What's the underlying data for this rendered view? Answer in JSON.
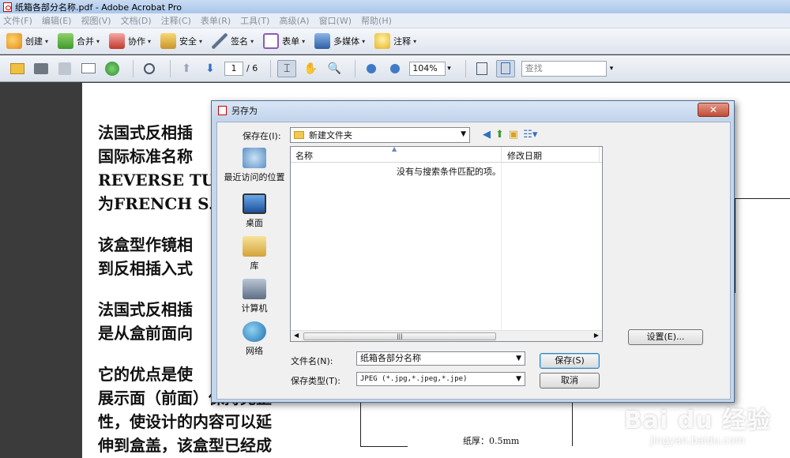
{
  "window": {
    "title": "纸箱各部分名称.pdf - Adobe Acrobat Pro"
  },
  "menu": [
    "文件(F)",
    "编辑(E)",
    "视图(V)",
    "文档(D)",
    "注释(C)",
    "表单(R)",
    "工具(T)",
    "高级(A)",
    "窗口(W)",
    "帮助(H)"
  ],
  "toolbar1": {
    "create": "创建",
    "combine": "合并",
    "collaborate": "协作",
    "secure": "安全",
    "sign": "签名",
    "forms": "表单",
    "multimedia": "多媒体",
    "comment": "注释"
  },
  "toolbar2": {
    "current_page": "1",
    "total_pages": "/ 6",
    "zoom": "104%",
    "find_placeholder": "查找"
  },
  "document": {
    "paragraphs": [
      [
        "法国式反相插",
        "国际标准名称",
        "REVERSE TUCK",
        "为FRENCH S.T"
      ],
      [
        "该盒型作镜相",
        "到反相插入式"
      ],
      [
        "法国式反相插",
        "是从盒前面向"
      ],
      [
        "它的优点是使",
        "展示面（前面）保持完整",
        "性，使设计的内容可以延",
        "伸到盒盖，该盒型已经成"
      ]
    ],
    "caption": "纸厚：0.5mm"
  },
  "dialog": {
    "title": "另存为",
    "close_label": "✕",
    "save_in_label": "保存在(I):",
    "save_in_value": "新建文件夹",
    "places": [
      "最近访问的位置",
      "桌面",
      "库",
      "计算机",
      "网络"
    ],
    "columns": [
      "名称",
      "修改日期"
    ],
    "empty_message": "没有与搜索条件匹配的项。",
    "filename_label": "文件名(N):",
    "filename_value": "纸箱各部分名称",
    "filetype_label": "保存类型(T):",
    "filetype_value": "JPEG (*.jpg,*.jpeg,*.jpe)",
    "save_button": "保存(S)",
    "cancel_button": "取消",
    "settings_button": "设置(E)..."
  },
  "watermark": {
    "line1": "Bai du 经验",
    "line2": "jingyan.baidu.com"
  }
}
